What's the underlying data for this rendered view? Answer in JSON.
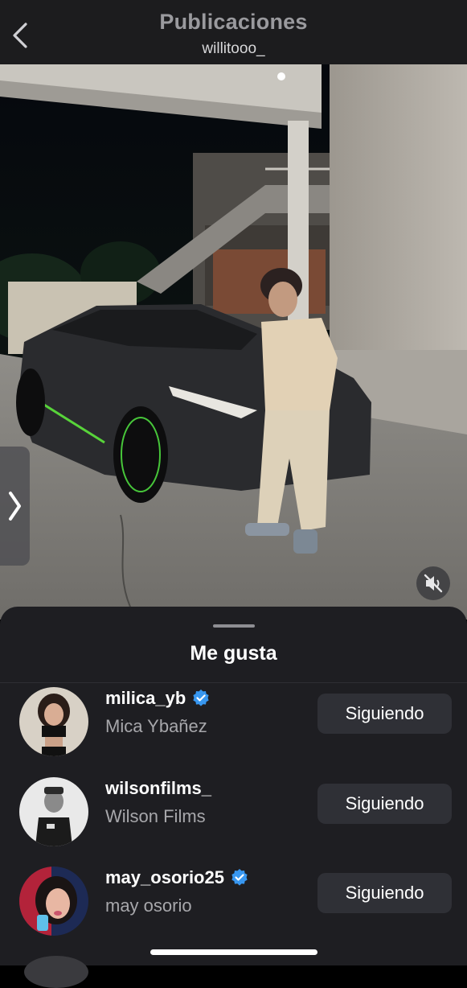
{
  "header": {
    "title": "Publicaciones",
    "username": "willitooo_"
  },
  "sheet": {
    "title": "Me gusta",
    "users": [
      {
        "username": "milica_yb",
        "full_name": "Mica Ybañez",
        "verified": true,
        "button": "Siguiendo"
      },
      {
        "username": "wilsonfilms_",
        "full_name": "Wilson Films",
        "verified": false,
        "button": "Siguiendo"
      },
      {
        "username": "may_osorio25",
        "full_name": "may osorio",
        "verified": true,
        "button": "Siguiendo"
      }
    ]
  },
  "icons": {
    "back": "chevron-left-icon",
    "next": "chevron-right-icon",
    "mute": "speaker-muted-icon",
    "verified": "verified-badge-icon"
  },
  "colors": {
    "verified": "#3897f0",
    "button_bg": "#2f3036",
    "sheet_bg": "#1e1e22"
  }
}
